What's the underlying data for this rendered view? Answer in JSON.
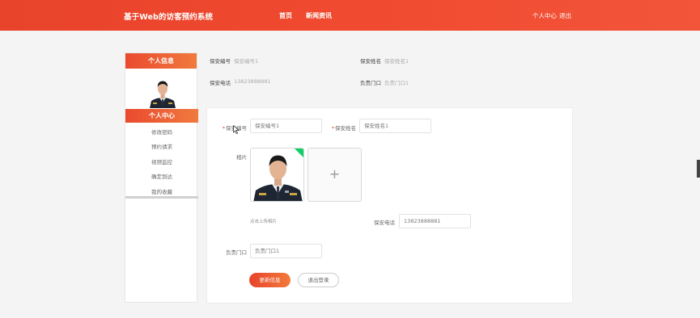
{
  "header": {
    "brand": "基于Web的访客预约系统",
    "nav": {
      "home": "首页",
      "news": "新闻资讯"
    },
    "right": {
      "personal_center": "个人中心",
      "logout": "退出"
    }
  },
  "sidebar": {
    "title": "个人信息",
    "active_item": "个人中心",
    "items": [
      "修改密码",
      "预约请求",
      "视频监控",
      "确定到达",
      "我的收藏"
    ]
  },
  "info": {
    "guard_no_label": "保安编号",
    "guard_no_value": "保安编号1",
    "guard_name_label": "保安姓名",
    "guard_name_value": "保安姓名1",
    "phone_label": "保安电话",
    "phone_value": "13823888881",
    "gate_label": "负责门口",
    "gate_value": "负责门口1"
  },
  "form": {
    "guard_no_label": "保安编号",
    "guard_no_value": "保安编号1",
    "guard_name_label": "保安姓名",
    "guard_name_value": "保安姓名1",
    "photo_label": "相片",
    "upload_plus": "+",
    "upload_hint": "点击上传相片",
    "phone_label": "保安电话",
    "phone_value": "13823888881",
    "gate_label": "负责门口",
    "gate_value": "负责门口1",
    "required_mark": "*",
    "update_button": "更新信息",
    "logout_button": "退出登录"
  },
  "colors": {
    "accent": "#e8432b",
    "accent_end": "#f27a3c",
    "success_flag": "#13ce66"
  }
}
